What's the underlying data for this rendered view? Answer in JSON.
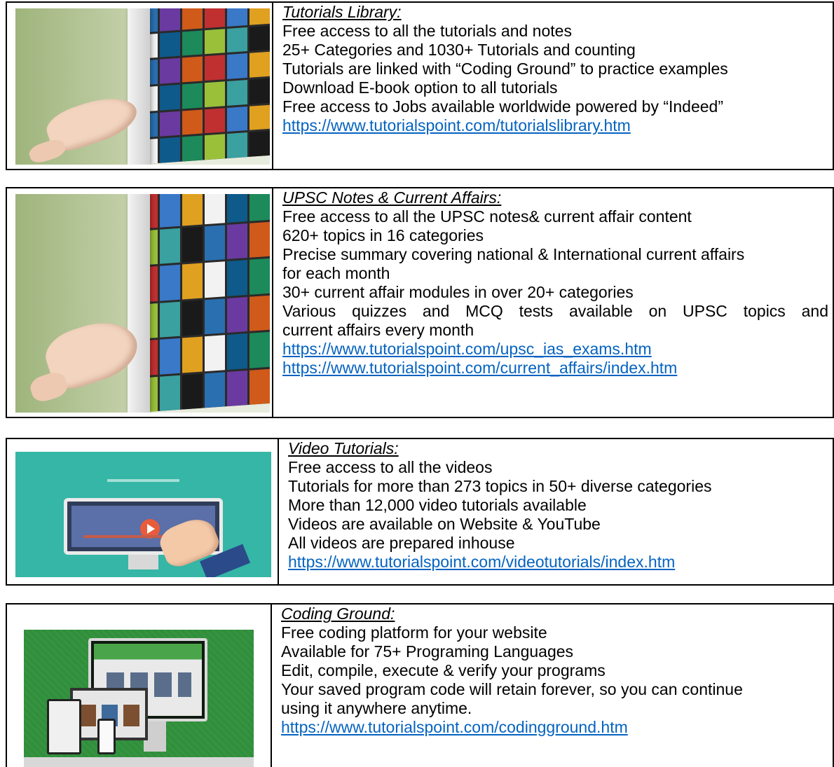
{
  "sections": [
    {
      "heading": "Tutorials Library:",
      "lines": [
        "Free access to all the tutorials and notes",
        "25+ Categories and 1030+ Tutorials and counting",
        "Tutorials are linked with “Coding Ground” to practice examples",
        "Download E-book option to all tutorials",
        "Free access to Jobs available worldwide powered by “Indeed”"
      ],
      "links": [
        "https://www.tutorialspoint.com/tutorialslibrary.htm"
      ]
    },
    {
      "heading": "UPSC Notes & Current Affairs:",
      "lines": [
        "Free access to all the UPSC notes& current affair content",
        "620+ topics in 16 categories",
        "Precise summary covering national & International current affairs",
        "for each month",
        "30+ current affair modules in over 20+ categories",
        "Various quizzes and MCQ tests available on UPSC topics and",
        "current affairs every month"
      ],
      "links": [
        "https://www.tutorialspoint.com/upsc_ias_exams.htm",
        "https://www.tutorialspoint.com/current_affairs/index.htm"
      ]
    },
    {
      "heading": "Video Tutorials:",
      "lines": [
        "Free access to all the videos",
        "Tutorials for more than 273 topics in 50+ diverse categories",
        "More than 12,000 video tutorials available",
        "Videos are available on Website & YouTube",
        "All videos are prepared inhouse"
      ],
      "links": [
        "https://www.tutorialspoint.com/videotutorials/index.htm"
      ]
    },
    {
      "heading": "Coding Ground:",
      "lines": [
        "Free coding platform for your website",
        "Available for 75+ Programing Languages",
        "Edit, compile, execute & verify your programs",
        "Your saved program code will retain forever, so you can continue",
        "using it anywhere anytime."
      ],
      "links": [
        "https://www.tutorialspoint.com/codingground.htm"
      ]
    }
  ],
  "colors": {
    "link": "#0563c1",
    "border": "#000000",
    "video_bg": "#35b6a6",
    "coding_bg": "#2f8f3a"
  },
  "images": [
    "tutorials-library-illustration",
    "upsc-notes-illustration",
    "video-tutorials-illustration",
    "coding-ground-illustration"
  ]
}
